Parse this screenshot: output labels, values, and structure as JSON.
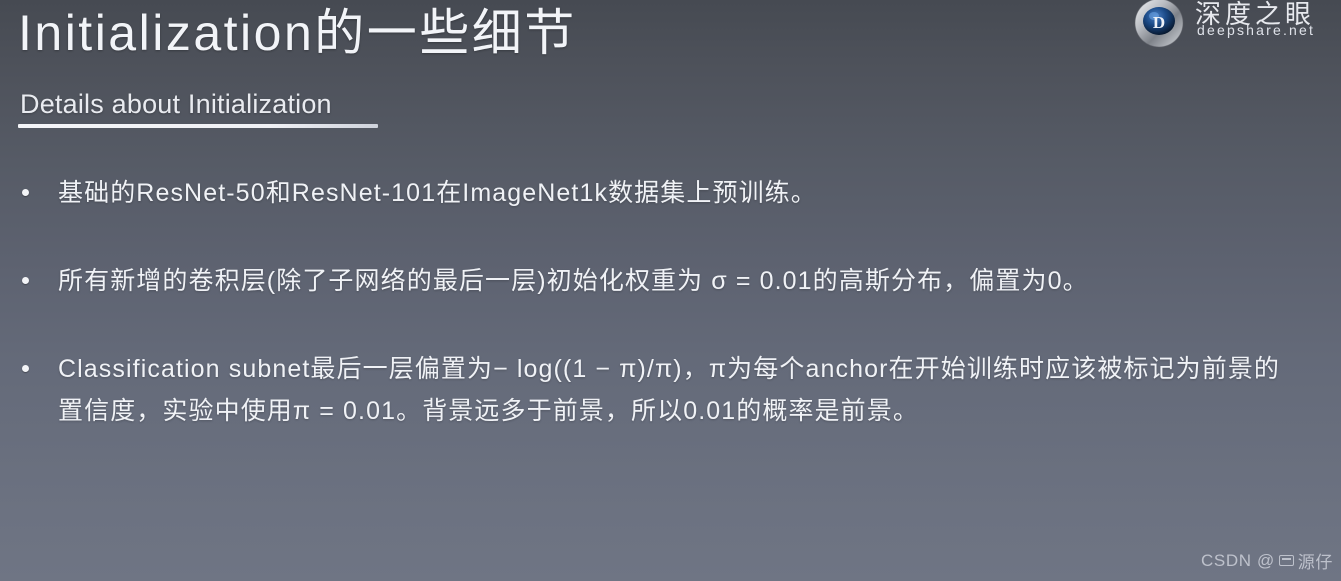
{
  "slide": {
    "title": "Initialization的一些细节",
    "subtitle": "Details about Initialization"
  },
  "logo": {
    "name_cn": "深度之眼",
    "name_en": "deepshare.net",
    "mark_letter": "D"
  },
  "bullets": [
    {
      "text": "基础的ResNet-50和ResNet-101在ImageNet1k数据集上预训练。"
    },
    {
      "text": "所有新增的卷积层(除了子网络的最后一层)初始化权重为 σ = 0.01的高斯分布，偏置为0。"
    },
    {
      "text": "Classification subnet最后一层偏置为− log((1 − π)/π)，π为每个anchor在开始训练时应该被标记为前景的置信度，实验中使用π = 0.01。背景远多于前景，所以0.01的概率是前景。"
    }
  ],
  "watermark": {
    "text_prefix": "CSDN @",
    "text_user": "源仔"
  },
  "colors": {
    "background_top": "#464a52",
    "background_bottom": "#6f7584",
    "text": "#f0f2f6",
    "rule": "#f4f5f8",
    "watermark": "#c9ccd6",
    "logo_mark_core": "#10305c"
  }
}
